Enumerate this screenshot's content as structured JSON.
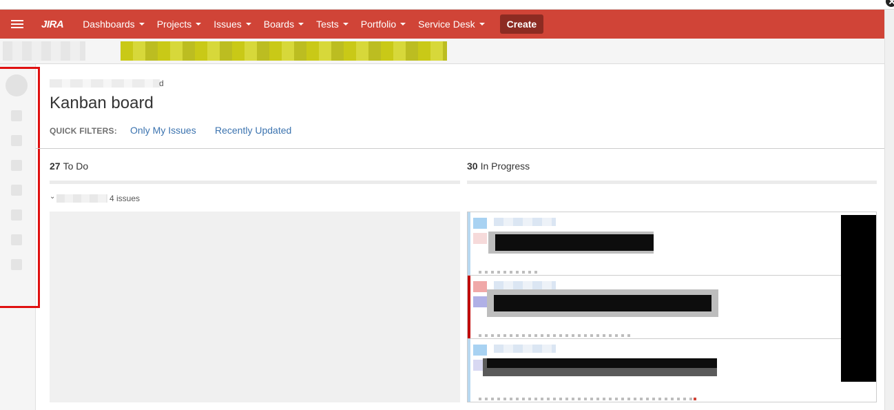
{
  "nav": {
    "logo": "JIRA",
    "items": [
      {
        "label": "Dashboards"
      },
      {
        "label": "Projects"
      },
      {
        "label": "Issues"
      },
      {
        "label": "Boards"
      },
      {
        "label": "Tests"
      },
      {
        "label": "Portfolio"
      },
      {
        "label": "Service Desk"
      }
    ],
    "create_label": "Create"
  },
  "breadcrumb": {
    "visible_suffix": "d"
  },
  "page": {
    "title": "Kanban board"
  },
  "quick_filters": {
    "label": "QUICK FILTERS:",
    "filters": [
      {
        "label": "Only My Issues"
      },
      {
        "label": "Recently Updated"
      }
    ]
  },
  "columns": [
    {
      "count": "27",
      "name": "To Do"
    },
    {
      "count": "30",
      "name": "In Progress"
    }
  ],
  "swimlane": {
    "count_label": "4 issues"
  },
  "colors": {
    "navbar": "#d04437",
    "create_button": "#8c2b22",
    "link": "#3b73af",
    "highlight_border": "#e01010"
  },
  "icons": [
    "menu-icon",
    "jira-logo-icon",
    "chevron-down-icon",
    "close-icon"
  ]
}
